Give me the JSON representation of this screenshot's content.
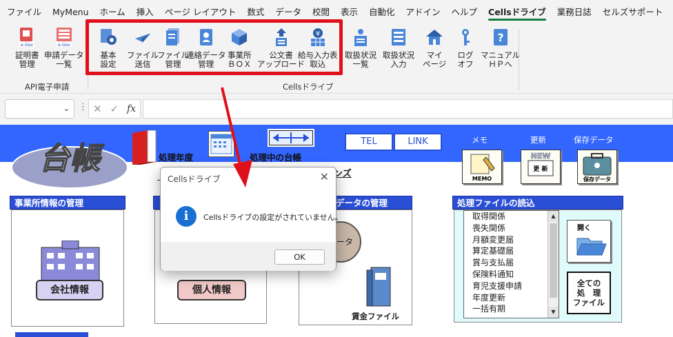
{
  "menu": [
    "ファイル",
    "MyMenu",
    "ホーム",
    "挿入",
    "ページ レイアウト",
    "数式",
    "データ",
    "校閲",
    "表示",
    "自動化",
    "アドイン",
    "ヘルプ",
    "Cellsドライブ",
    "業務日誌",
    "セルズサポート"
  ],
  "ribbon": {
    "group_api": "API電子申請",
    "group_cells": "Cellsドライブ",
    "buttons": [
      {
        "l1": "証明書",
        "l2": "管理"
      },
      {
        "l1": "申請データ",
        "l2": "一覧"
      },
      {
        "l1": "基本",
        "l2": "設定"
      },
      {
        "l1": "ファイル",
        "l2": "送信"
      },
      {
        "l1": "ファイル",
        "l2": "管理"
      },
      {
        "l1": "連絡データ",
        "l2": "管理"
      },
      {
        "l1": "事業所",
        "l2": "ＢＯＸ"
      },
      {
        "l1": "公文書",
        "l2": "アップロード"
      },
      {
        "l1": "給与入力表",
        "l2": "取込"
      },
      {
        "l1": "取扱状況",
        "l2": "一覧"
      },
      {
        "l1": "取扱状況",
        "l2": "入力"
      },
      {
        "l1": "マイ",
        "l2": "ページ"
      },
      {
        "l1": "ログ",
        "l2": "オフ"
      },
      {
        "l1": "マニュアル",
        "l2": "ＨＰへ"
      }
    ],
    "egov": "e-Gov"
  },
  "formula_bar": {
    "fx": "fx"
  },
  "sheet": {
    "logo": "台帳",
    "nendo": "処理年度",
    "shorichu": "処理中の台帳",
    "tel": "TEL",
    "link": "LINK",
    "memo_label": "メモ",
    "memo_btn": "MEMO",
    "update_label": "更新",
    "update_new": "NEW",
    "update_btn": "更 新",
    "save_label": "保存データ",
    "save_btn": "保存データ",
    "underline_text": "ンズ",
    "sec_office": "事業所情報の管理",
    "sec_data": "データの管理",
    "sec_files": "処理ファイルの読込",
    "company": "会社情報",
    "personal": "個人情報",
    "data_circle": "データ",
    "binder_label": "賃金ファイル",
    "file_list": [
      "取得関係",
      "喪失関係",
      "月額変更届",
      "算定基礎届",
      "賞与支払届",
      "保険料通知",
      "育児支援申請",
      "年度更新",
      "一括有期"
    ],
    "open": "開く",
    "all_files": [
      "全ての",
      "処　理",
      "ファイル"
    ]
  },
  "dialog": {
    "title": "Cellsドライブ",
    "message": "Cellsドライブの設定がされていません。",
    "ok": "OK"
  }
}
